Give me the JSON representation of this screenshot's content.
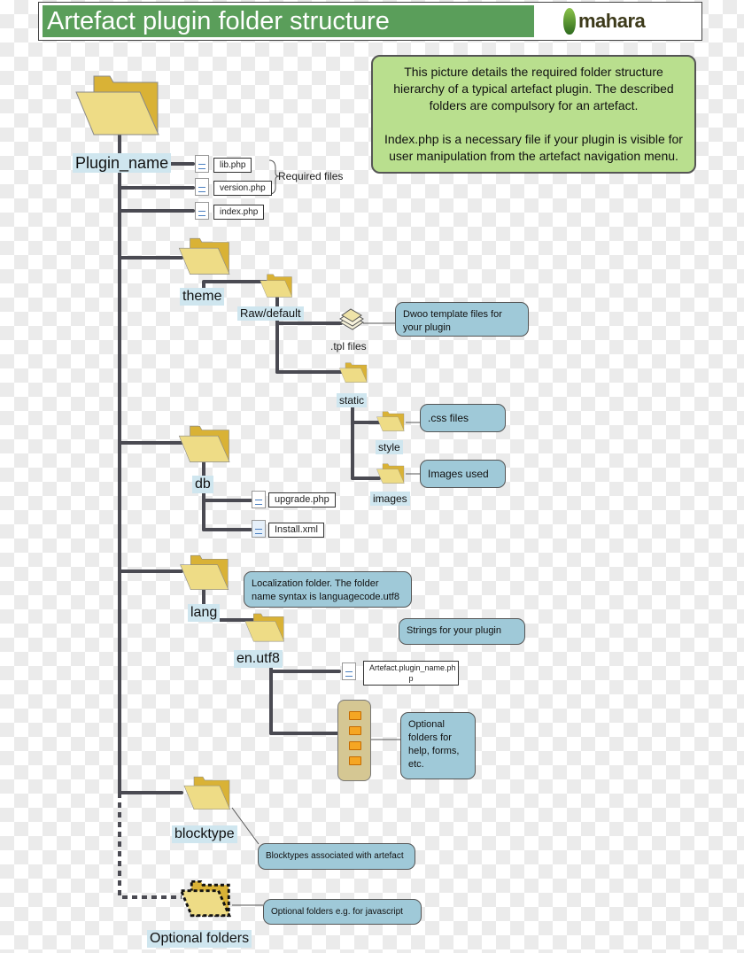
{
  "header": {
    "title": "Artefact plugin  folder structure",
    "logo_text": "mahara"
  },
  "intro": {
    "paragraph1": "This picture details the required folder structure hierarchy of a typical artefact plugin. The described folders are compulsory for an artefact.",
    "paragraph2": "Index.php is a necessary file if your plugin is visible for user manipulation from the artefact navigation menu."
  },
  "tree": {
    "root": "Plugin_name",
    "required_files_label": "Required files",
    "root_files": [
      "lib.php",
      "version.php",
      "index.php"
    ],
    "theme": {
      "label": "theme",
      "raw_default": "Raw/default",
      "tpl_files": ".tpl files",
      "tpl_callout": "Dwoo template files for your plugin",
      "static": "static",
      "style": "style",
      "style_callout": ".css files",
      "images": "images",
      "images_callout": "Images used"
    },
    "db": {
      "label": "db",
      "files": [
        "upgrade.php",
        "Install.xml"
      ]
    },
    "lang": {
      "label": "lang",
      "callout": "Localization folder. The folder name syntax is languagecode.utf8",
      "en_utf8": "en.utf8",
      "file": "Artefact.plugin_name.ph p",
      "file_callout": "Strings for your plugin",
      "optional_callout": "Optional folders for help, forms, etc."
    },
    "blocktype": {
      "label": "blocktype",
      "callout": "Blocktypes associated with artefact"
    },
    "optional": {
      "label": "Optional folders",
      "callout": "Optional folders e.g. for javascript"
    }
  },
  "colors": {
    "title_bar": "#5a9e5a",
    "intro_bg": "#b9df8e",
    "callout_bg": "#9fc9d8",
    "label_bg": "#cfe6ef",
    "folder": "#e8c440",
    "line": "#4a4a52"
  }
}
